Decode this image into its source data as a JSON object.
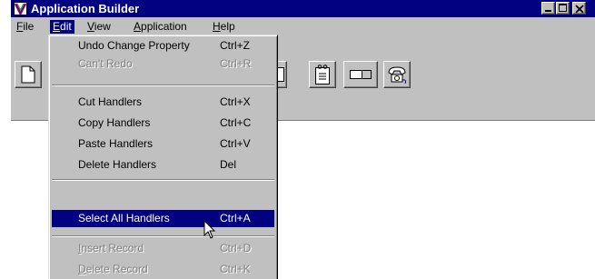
{
  "window": {
    "title": "Application Builder"
  },
  "menubar": {
    "items": [
      {
        "label": "File",
        "accel": "F",
        "rest": "ile"
      },
      {
        "label": "Edit",
        "accel": "E",
        "rest": "dit"
      },
      {
        "label": "View",
        "accel": "V",
        "rest": "iew"
      },
      {
        "label": "Application",
        "accel": "A",
        "rest": "pplication"
      },
      {
        "label": "Help",
        "accel": "H",
        "rest": "elp"
      }
    ],
    "active": "Edit"
  },
  "toolbar": {
    "buttons": [
      "new-icon",
      "sheet-icon",
      "form-icon",
      "entry-field-icon",
      "telephone-icon"
    ]
  },
  "edit_menu": {
    "items": [
      {
        "label": "Undo Change Property",
        "shortcut": "Ctrl+Z",
        "enabled": true
      },
      {
        "label": "Can't Redo",
        "shortcut": "Ctrl+R",
        "enabled": false
      },
      {
        "label": "Cut Handlers",
        "shortcut": "Ctrl+X",
        "enabled": true
      },
      {
        "label": "Copy Handlers",
        "shortcut": "Ctrl+C",
        "enabled": true
      },
      {
        "label": "Paste Handlers",
        "shortcut": "Ctrl+V",
        "enabled": true
      },
      {
        "label": "Delete Handlers",
        "shortcut": "Del",
        "enabled": true
      },
      {
        "label": "Select All Handlers",
        "shortcut": "Ctrl+A",
        "enabled": true,
        "selected": true
      },
      {
        "label": "Insert Record",
        "accel": "I",
        "rest": "nsert Record",
        "shortcut": "Ctrl+D",
        "enabled": false
      },
      {
        "label": "Delete Record",
        "accel": "D",
        "rest": "elete Record",
        "shortcut": "Ctrl+K",
        "enabled": false
      }
    ]
  },
  "colors": {
    "titlebar": "#000080",
    "face": "#c0c0c0",
    "highlight": "#000080",
    "disabled_text": "#808080"
  }
}
